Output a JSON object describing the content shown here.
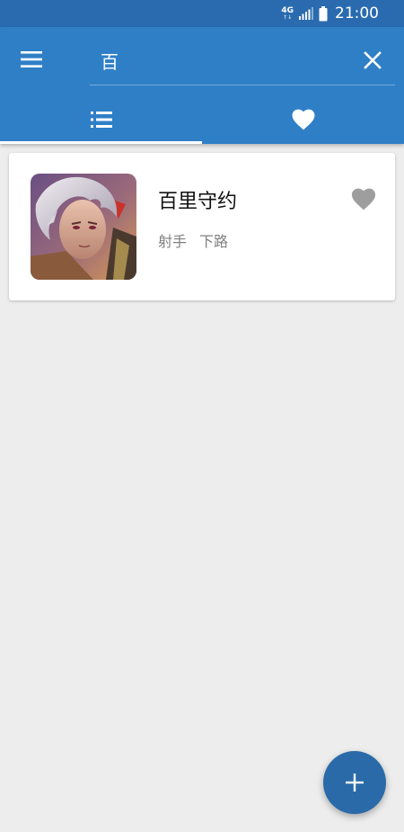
{
  "status_bar": {
    "network_type": "4G",
    "network_arrows": "↑↓",
    "time": "21:00",
    "icons": [
      "network-4g-icon",
      "signal-icon",
      "battery-icon"
    ]
  },
  "app_bar": {
    "menu_icon": "hamburger-menu-icon",
    "search": {
      "value": "百",
      "placeholder": ""
    },
    "clear_icon": "close-icon",
    "tabs": [
      {
        "icon": "list-icon",
        "selected": true
      },
      {
        "icon": "heart-icon",
        "selected": false
      }
    ]
  },
  "results": [
    {
      "name": "百里守约",
      "tags": [
        "射手",
        "下路"
      ],
      "favorite": false
    }
  ],
  "fab": {
    "icon": "plus-icon"
  },
  "colors": {
    "status_bar": "#2a6bb0",
    "app_bar": "#2f7fc7",
    "background": "#ededed",
    "fab": "#2a6aa8",
    "heart_inactive": "#9e9e9e"
  }
}
